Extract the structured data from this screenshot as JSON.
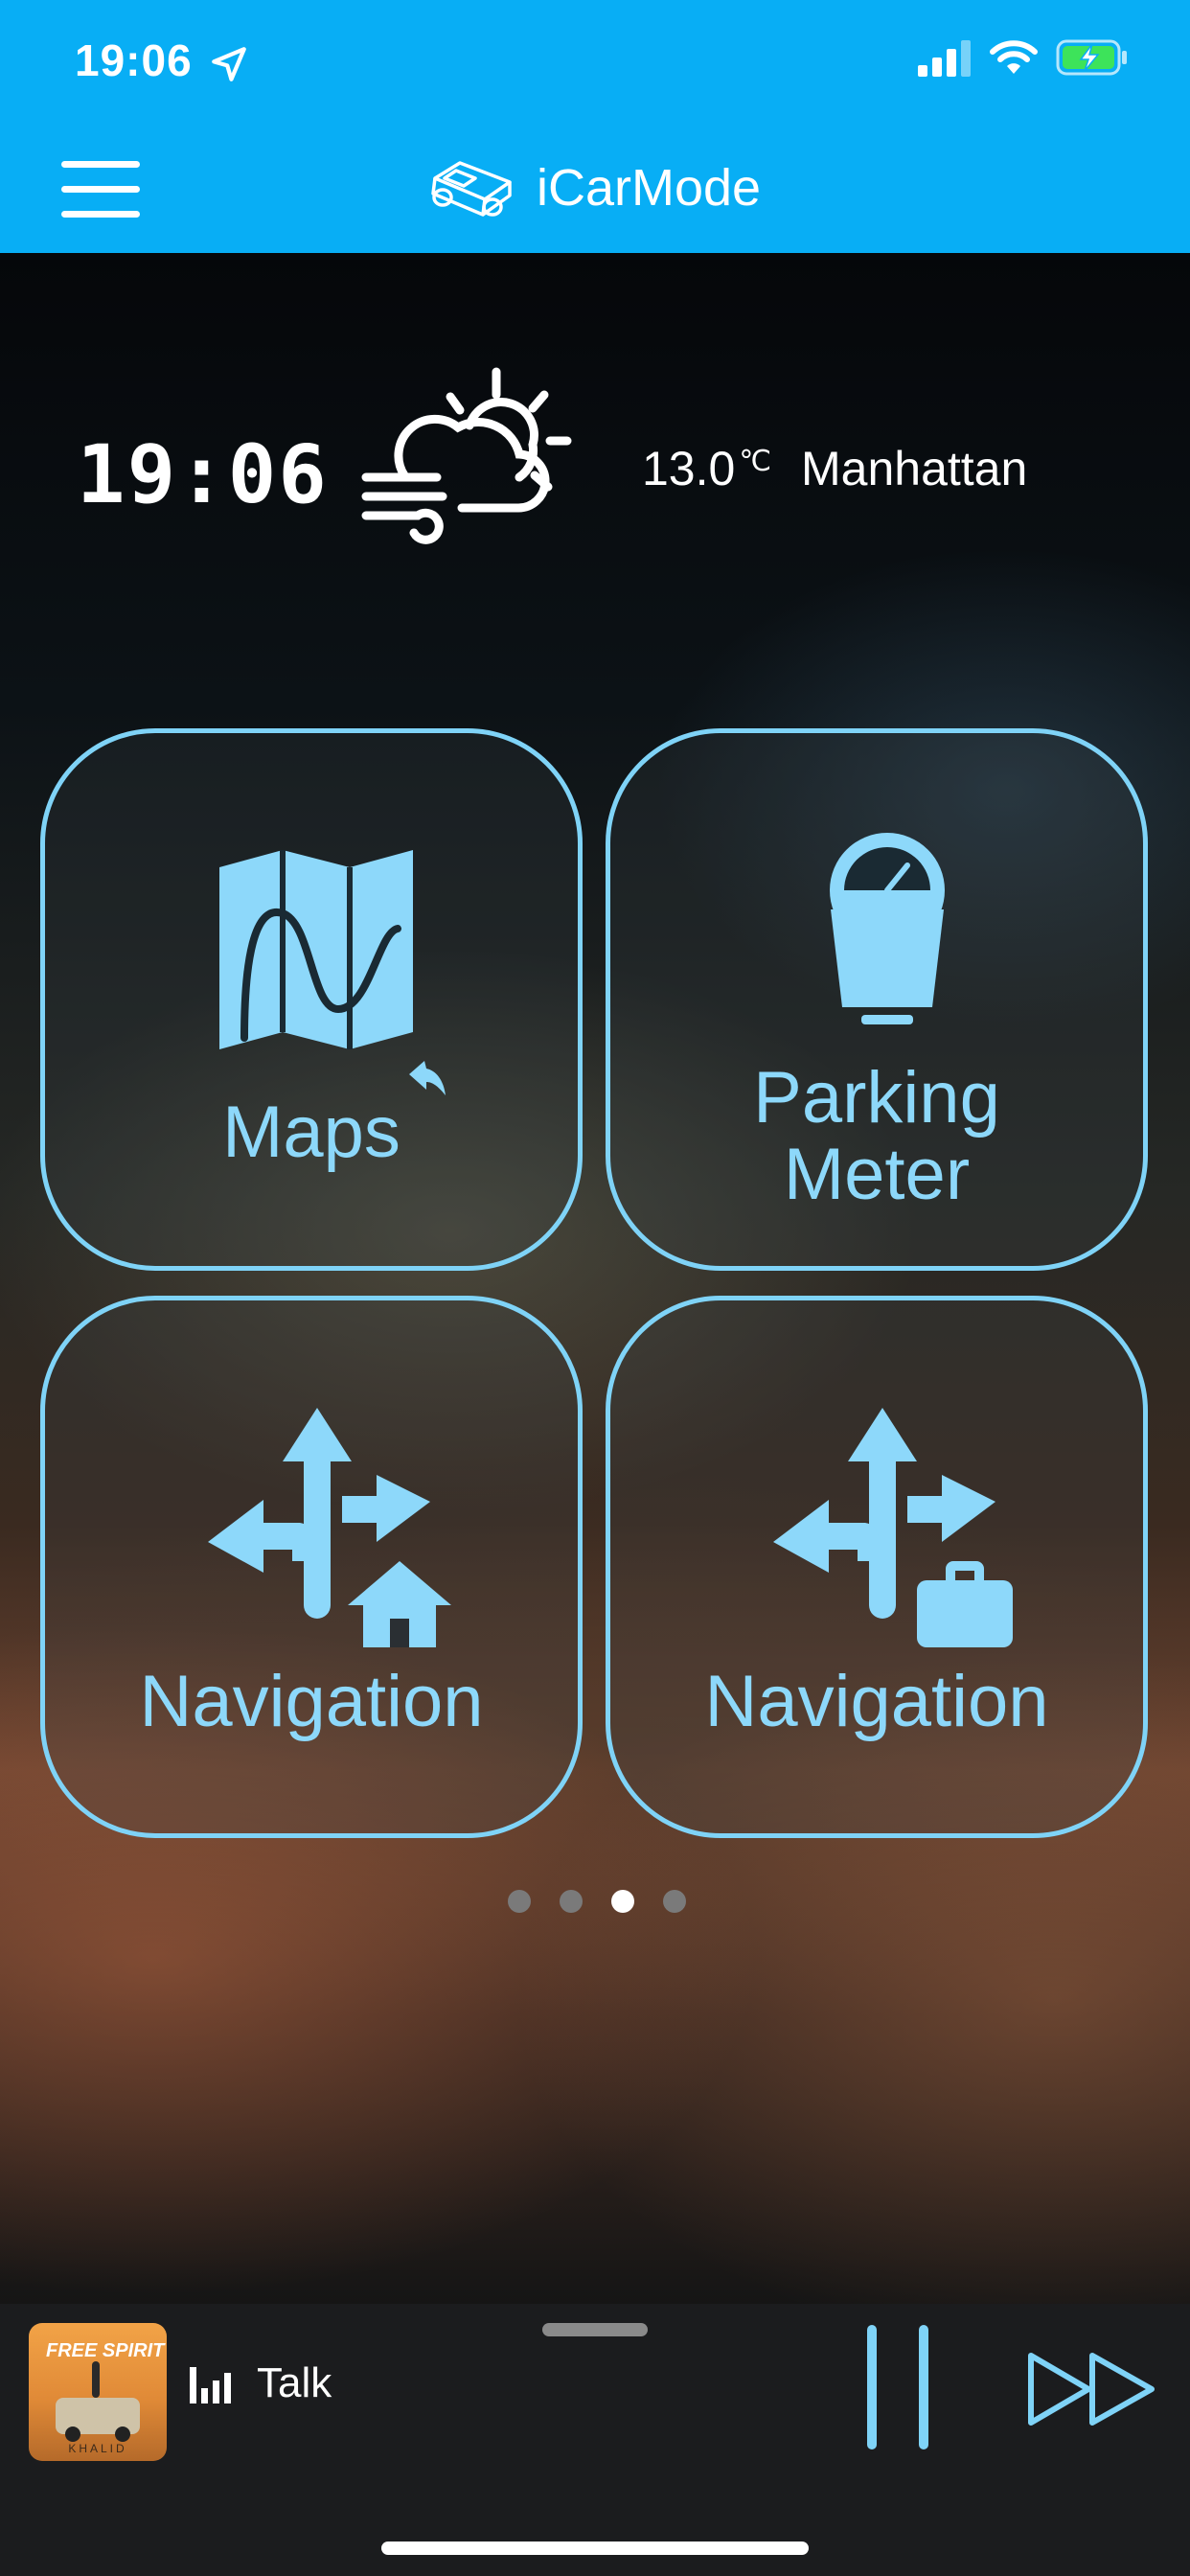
{
  "status_bar": {
    "time": "19:06",
    "location_icon": "location-arrow-icon",
    "signal_icon": "cellular-signal-icon",
    "wifi_icon": "wifi-icon",
    "battery_icon": "battery-charging-icon"
  },
  "header": {
    "menu_icon": "hamburger-menu-icon",
    "logo_icon": "car-logo-icon",
    "title": "iCarMode",
    "background_color": "#08aef5"
  },
  "dashboard": {
    "clock": "19:06",
    "weather_icon": "partly-cloudy-windy-icon",
    "temperature": "13.0",
    "temperature_unit": "℃",
    "city": "Manhattan"
  },
  "tiles": [
    {
      "label": "Maps",
      "icon": "map-icon"
    },
    {
      "label_line1": "Parking",
      "label_line2": "Meter",
      "icon": "parking-meter-icon"
    },
    {
      "label": "Navigation",
      "icon": "navigation-home-icon"
    },
    {
      "label": "Navigation",
      "icon": "navigation-work-icon"
    }
  ],
  "accent_color": "#7fd3f7",
  "pager": {
    "page_count": 4,
    "active_page": 3
  },
  "player": {
    "album_title": "FREE SPIRIT",
    "album_artist": "KHALID",
    "track": "Talk",
    "pause_icon": "pause-icon",
    "forward_icon": "fast-forward-icon",
    "bars_icon": "audio-bars-icon"
  }
}
